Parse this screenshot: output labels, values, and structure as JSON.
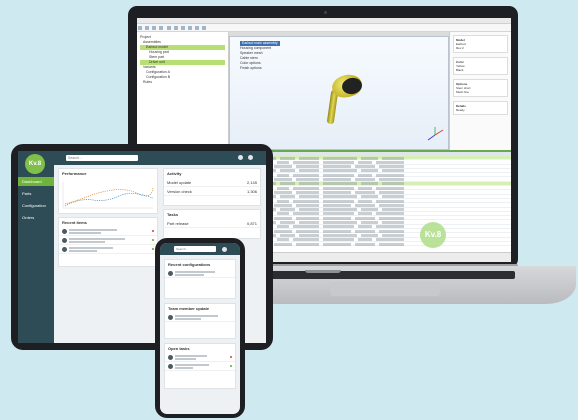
{
  "brand": {
    "logo_text": "Kv.8",
    "accent": "#6fb33b",
    "dark": "#2e4c55"
  },
  "laptop": {
    "tree_items": [
      "Project",
      "Assemblies",
      "Earbud model",
      "Housing part",
      "Stem part",
      "Driver unit",
      "Variants",
      "Configuration A",
      "Configuration B",
      "Rules"
    ],
    "viewport_list": [
      "Earbud main assembly",
      "Housing component",
      "Speaker mesh",
      "Cable stem",
      "Color options",
      "Finish options"
    ],
    "property_groups": [
      {
        "title": "Model",
        "lines": [
          "Earbud",
          "Rev 2"
        ]
      },
      {
        "title": "Color",
        "lines": [
          "Yellow",
          "Black"
        ]
      },
      {
        "title": "Options",
        "lines": [
          "Stem short",
          "Mesh fine"
        ]
      },
      {
        "title": "Details",
        "lines": [
          "Ready"
        ]
      }
    ],
    "grid_rows": 21,
    "highlight_rows": [
      0,
      6
    ]
  },
  "tablet": {
    "search_placeholder": "Search...",
    "nav": [
      "Dashboard",
      "Parts",
      "Configuration",
      "Orders"
    ],
    "chart_card_title": "Performance",
    "list_card_title": "Recent items",
    "right_card1_title": "Activity",
    "right_card2_title": "Tasks",
    "right_rows": [
      {
        "name": "Model update",
        "value": "2,145"
      },
      {
        "name": "Version check",
        "value": "1,306"
      },
      {
        "name": "Part release",
        "value": "0,871"
      }
    ]
  },
  "phone": {
    "search_placeholder": "Search...",
    "cards": [
      {
        "title": "Recent configurations"
      },
      {
        "title": "Team member update"
      },
      {
        "title": "Open tasks"
      }
    ]
  },
  "badge": {
    "text": "Kv.8"
  }
}
